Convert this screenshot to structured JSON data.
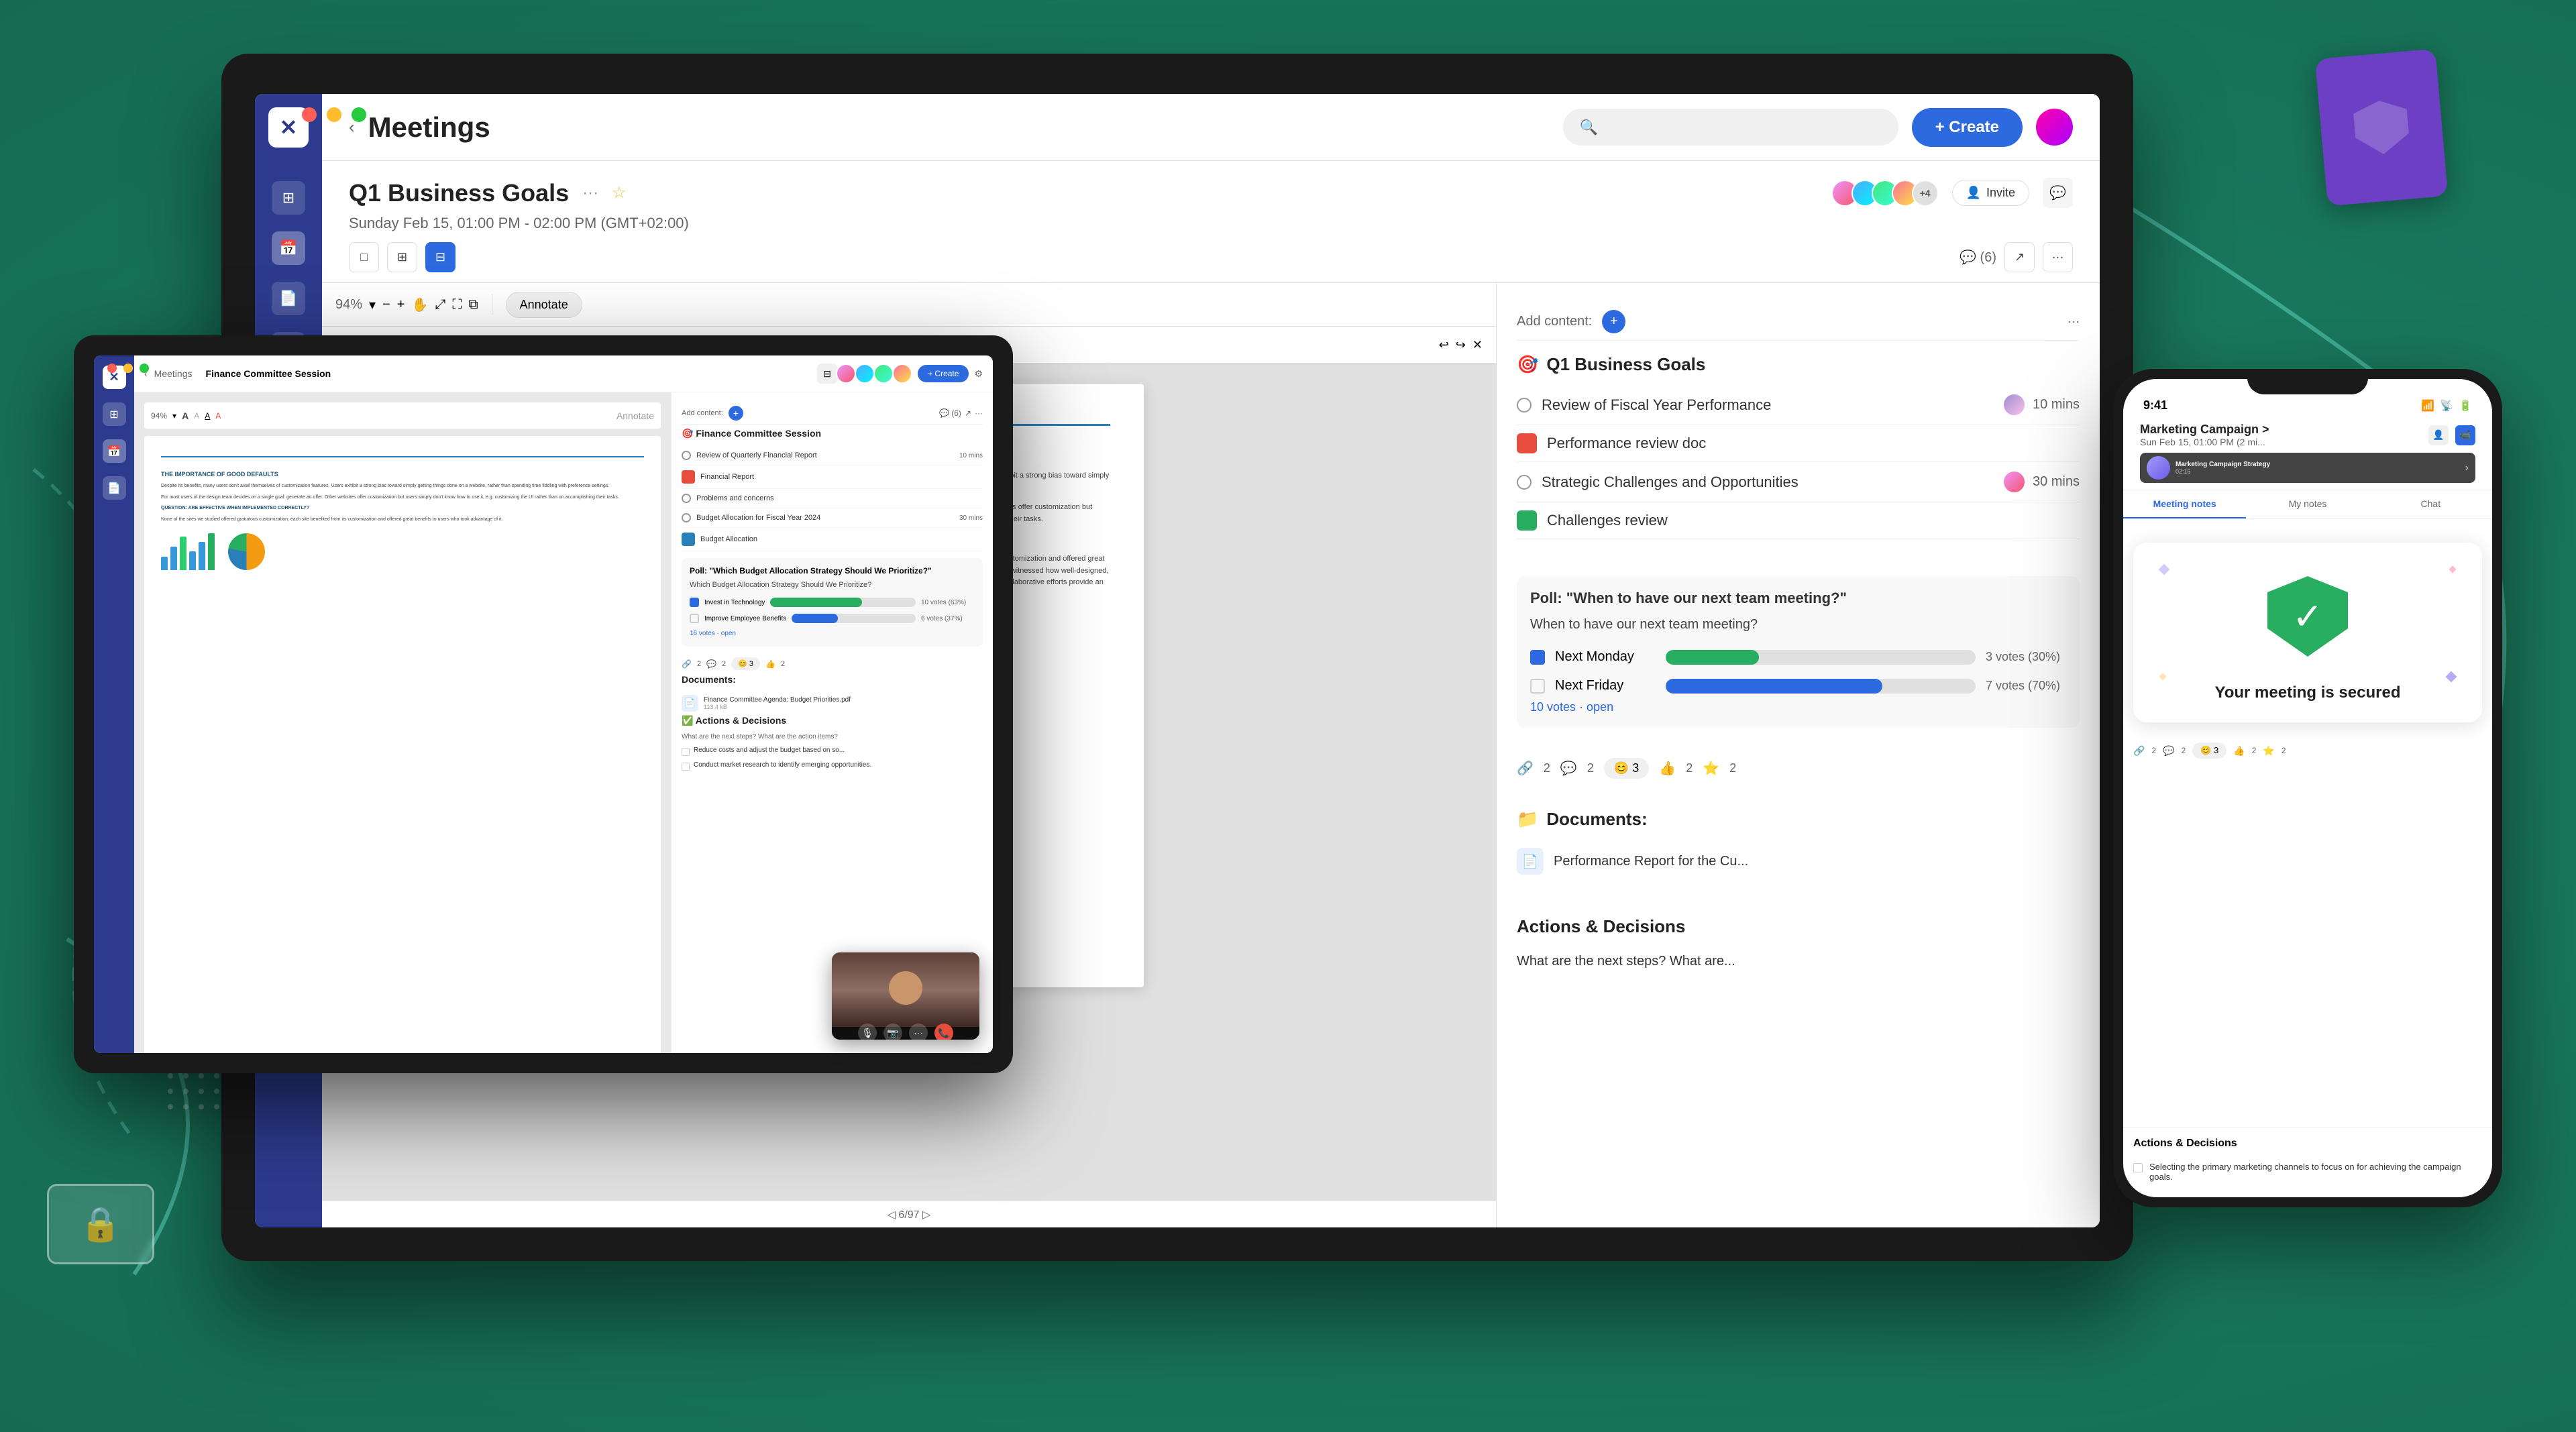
{
  "app": {
    "title": "Meetings",
    "create_label": "+ Create"
  },
  "laptop": {
    "meeting_title": "Q1 Business Goals",
    "meeting_subtitle": "Sunday Feb 15, 01:00 PM - 02:00 PM (GMT+02:00)",
    "zoom_level": "94%",
    "annotate_label": "Annotate",
    "add_content_label": "Add content:",
    "invite_label": "Invite",
    "avatar_count": "+4",
    "notes": {
      "section_title": "Q1 Business Goals",
      "items": [
        {
          "type": "circle",
          "text": "Review of Fiscal Year Performance",
          "time": "10 mins"
        },
        {
          "type": "pdf",
          "text": "Performance review doc",
          "time": ""
        },
        {
          "type": "circle",
          "text": "Strategic Challenges and Opportunities",
          "time": "30 mins"
        },
        {
          "type": "doc",
          "text": "Challenges review",
          "time": ""
        }
      ],
      "poll": {
        "title": "Poll: \"When to have our next team meeting?\"",
        "question": "When to have our next team meeting?",
        "option1": "Next Monday",
        "option2": "Next Friday",
        "option1_votes": "3 votes (30%)",
        "option2_votes": "7 votes (70%)",
        "option1_pct": 30,
        "option2_pct": 70,
        "total_link": "10 votes · open"
      },
      "documents_title": "Documents:",
      "documents": [
        {
          "text": "Performance Report for the Cu...",
          "icon": "📄"
        }
      ],
      "actions_title": "Actions & Decisions",
      "actions_description": "What are the next steps? What are..."
    }
  },
  "tablet": {
    "meeting_title": "Finance Committee Session",
    "meeting_subtitle": "Sunday Feb 15, 01:00 PM - 02:00 PM (GMT+02:00)",
    "notes": {
      "section_title": "Finance Committee Session",
      "items": [
        {
          "type": "circle",
          "text": "Review of Quarterly Financial Report",
          "time": "10 mins"
        },
        {
          "type": "pdf",
          "text": "Financial Report",
          "time": ""
        },
        {
          "type": "circle",
          "text": "Problems and concerns",
          "time": ""
        },
        {
          "type": "circle",
          "text": "Budget Allocation for Fiscal Year 2024",
          "time": "30 mins"
        },
        {
          "type": "doc",
          "text": "Budget Allocation",
          "time": ""
        }
      ],
      "poll": {
        "title": "Poll: \"Which Budget Allocation Strategy Should We Prioritize?\"",
        "question": "Which Budget Allocation Strategy Should We Prioritize?",
        "option1": "Invest in Technology",
        "option2": "Improve Employee Benefits",
        "option1_pct": 63,
        "option2_pct": 37,
        "option1_votes": "10 votes (63%)",
        "option2_votes": "6 votes (37%)",
        "total_link": "16 votes · open"
      },
      "documents_title": "Documents:",
      "documents": [
        {
          "text": "Finance Committee Agenda: Budget Priorities.pdf",
          "size": "113.4 kB"
        }
      ],
      "actions_title": "✅ Actions & Decisions",
      "actions": [
        "Reduce costs and adjust the budget based on so...",
        "Conduct market research to identify emerging opportunities."
      ]
    }
  },
  "phone": {
    "time": "9:41",
    "meeting_name": "Marketing Campaign >",
    "meeting_time": "Sun Feb 15, 01:00 PM (2 mi...",
    "tabs": [
      "Meeting notes",
      "My notes",
      "Chat"
    ],
    "active_tab": "Meeting notes",
    "security": {
      "title": "Your meeting is secured"
    },
    "actions_title": "Actions & Decisions",
    "actions": [
      "Selecting the primary marketing channels to focus on for achieving the campaign goals."
    ]
  },
  "decorative": {
    "shield_icon": "🛡️",
    "camera_icon": "🔒"
  }
}
